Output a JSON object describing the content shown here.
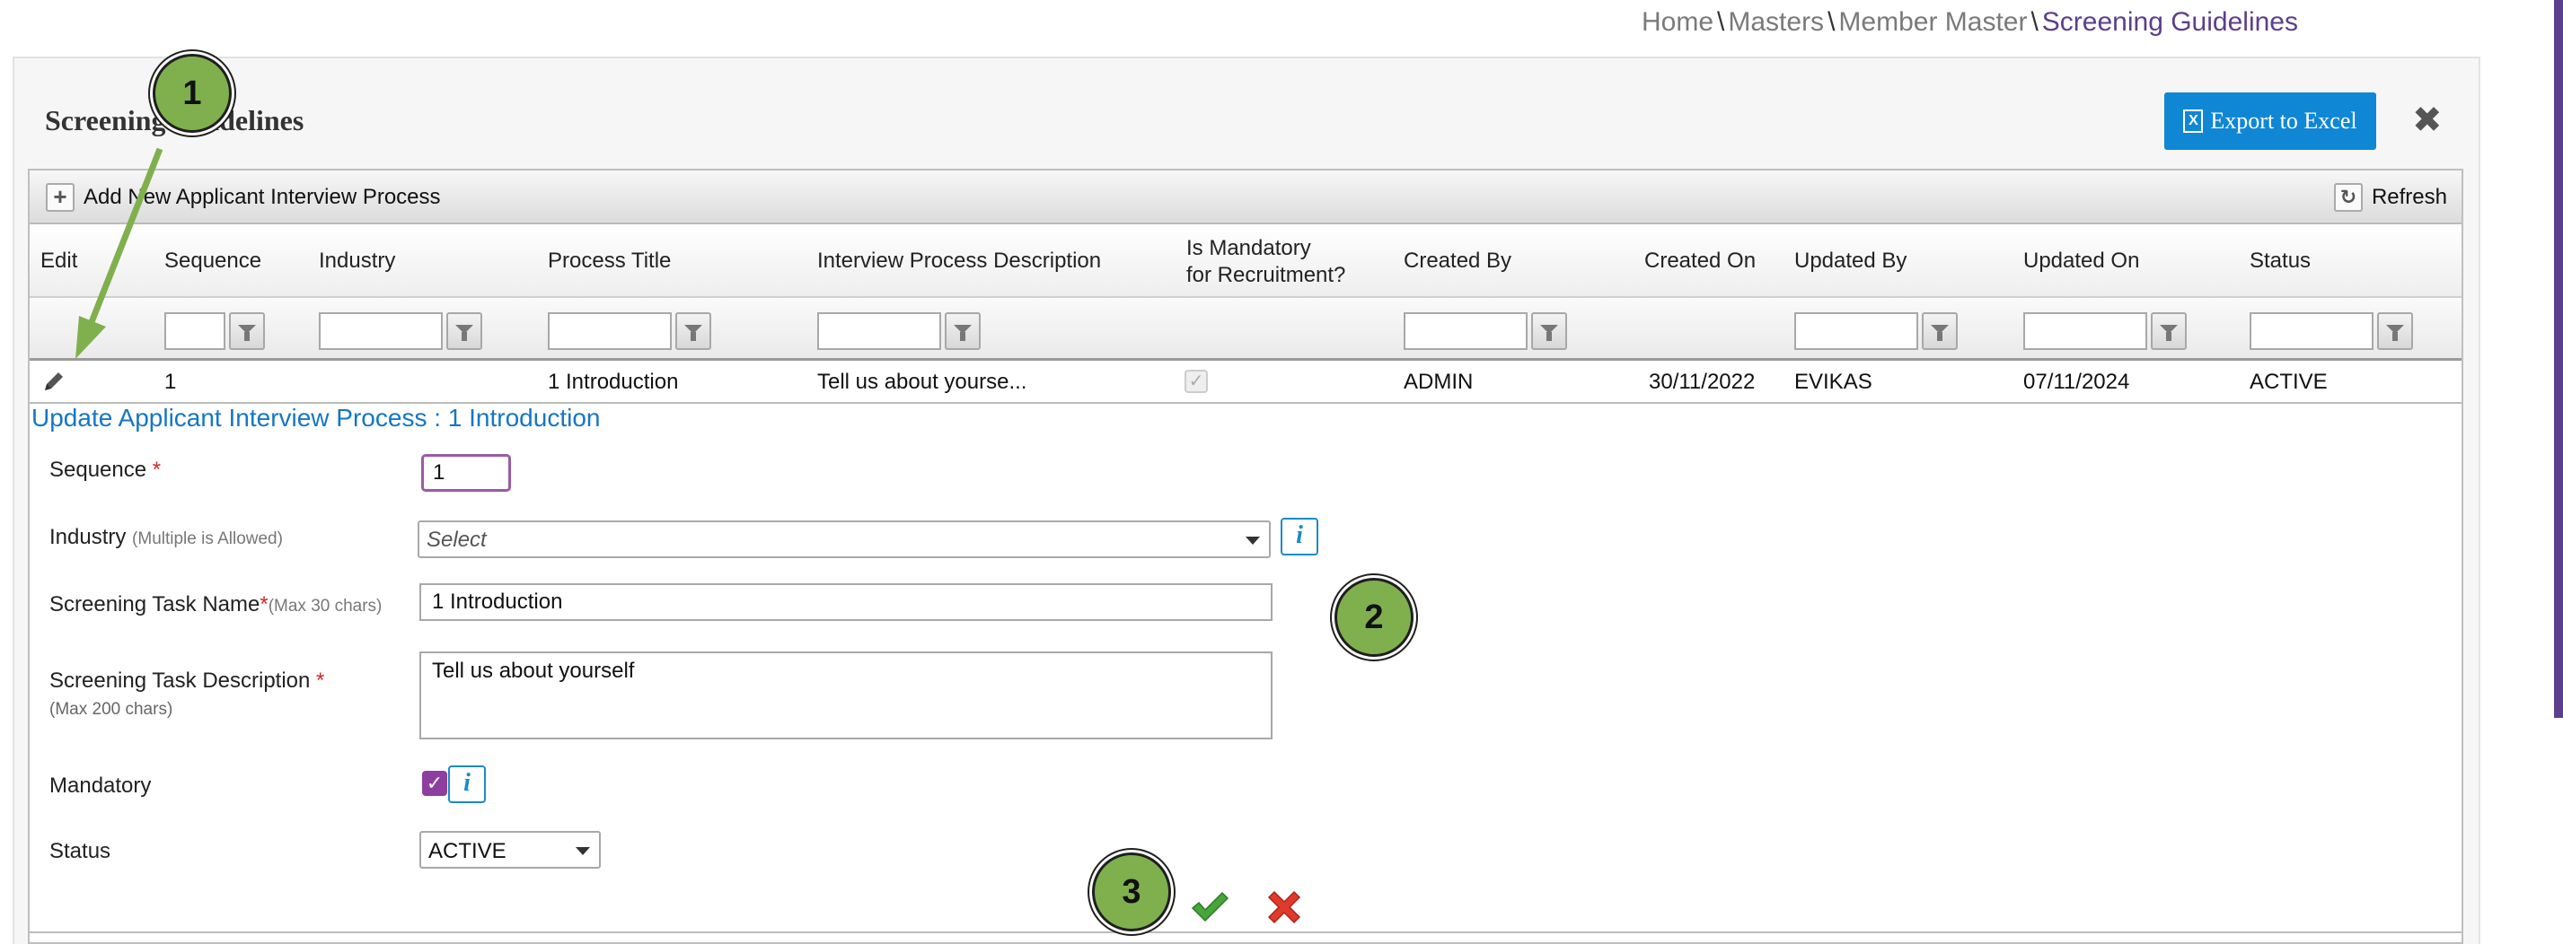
{
  "breadcrumb": {
    "items": [
      "Home",
      "Masters",
      "Member Master"
    ],
    "current": "Screening Guidelines",
    "separator": "\\"
  },
  "panel": {
    "title": "Screening Guidelines",
    "export_label": "Export to Excel",
    "close_symbol": "✖"
  },
  "toolbar": {
    "add_label": "Add New Applicant Interview Process",
    "add_symbol": "+",
    "refresh_label": "Refresh",
    "refresh_symbol": "↻"
  },
  "grid": {
    "columns": [
      "Edit",
      "Sequence",
      "Industry",
      "Process Title",
      "Interview Process Description",
      "Is Mandatory\nfor Recruitment?",
      "Created By",
      "Created On",
      "Updated By",
      "Updated On",
      "Status"
    ],
    "mandatory_header_line1": "Is Mandatory",
    "mandatory_header_line2": "for Recruitment?",
    "rows": [
      {
        "sequence": "1",
        "industry": "",
        "process_title": "1 Introduction",
        "description": "Tell us about yourse...",
        "is_mandatory": true,
        "created_by": "ADMIN",
        "created_on": "30/11/2022",
        "updated_by": "EVIKAS",
        "updated_on": "07/11/2024",
        "status": "ACTIVE"
      }
    ]
  },
  "form": {
    "title": "Update Applicant Interview Process : 1 Introduction",
    "sequence_label": "Sequence",
    "sequence_value": "1",
    "industry_label": "Industry",
    "industry_hint": "(Multiple is Allowed)",
    "industry_placeholder": "Select",
    "task_name_label": "Screening Task Name",
    "task_name_hint": "(Max 30 chars)",
    "task_name_value": "1 Introduction",
    "task_desc_label": "Screening Task Description",
    "task_desc_hint": "(Max 200 chars)",
    "task_desc_value": "Tell us about yourself",
    "mandatory_label": "Mandatory",
    "mandatory_checked": true,
    "status_label": "Status",
    "status_value": "ACTIVE",
    "required_mark": "*",
    "info_symbol": "i"
  },
  "annotations": {
    "markers": [
      "1",
      "2",
      "3"
    ],
    "marker_color": "#7fb04d"
  },
  "colors": {
    "accent": "#1087d4",
    "brand": "#5b3f8c",
    "link": "#1676c5",
    "required": "#d32626",
    "checkbox": "#8e3ea0"
  }
}
